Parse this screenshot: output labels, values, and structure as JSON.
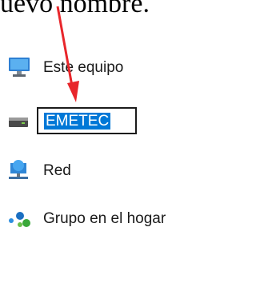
{
  "caption": "uevo nombre.",
  "nav": {
    "items": [
      {
        "label": "Este equipo",
        "icon": "computer-icon"
      },
      {
        "label": "",
        "icon": "drive-icon"
      },
      {
        "label": "Red",
        "icon": "network-icon"
      },
      {
        "label": "Grupo en el hogar",
        "icon": "homegroup-icon"
      }
    ]
  },
  "rename": {
    "value": "EMETEC"
  },
  "colors": {
    "accent": "#0078d7",
    "arrow": "#e8262b"
  }
}
